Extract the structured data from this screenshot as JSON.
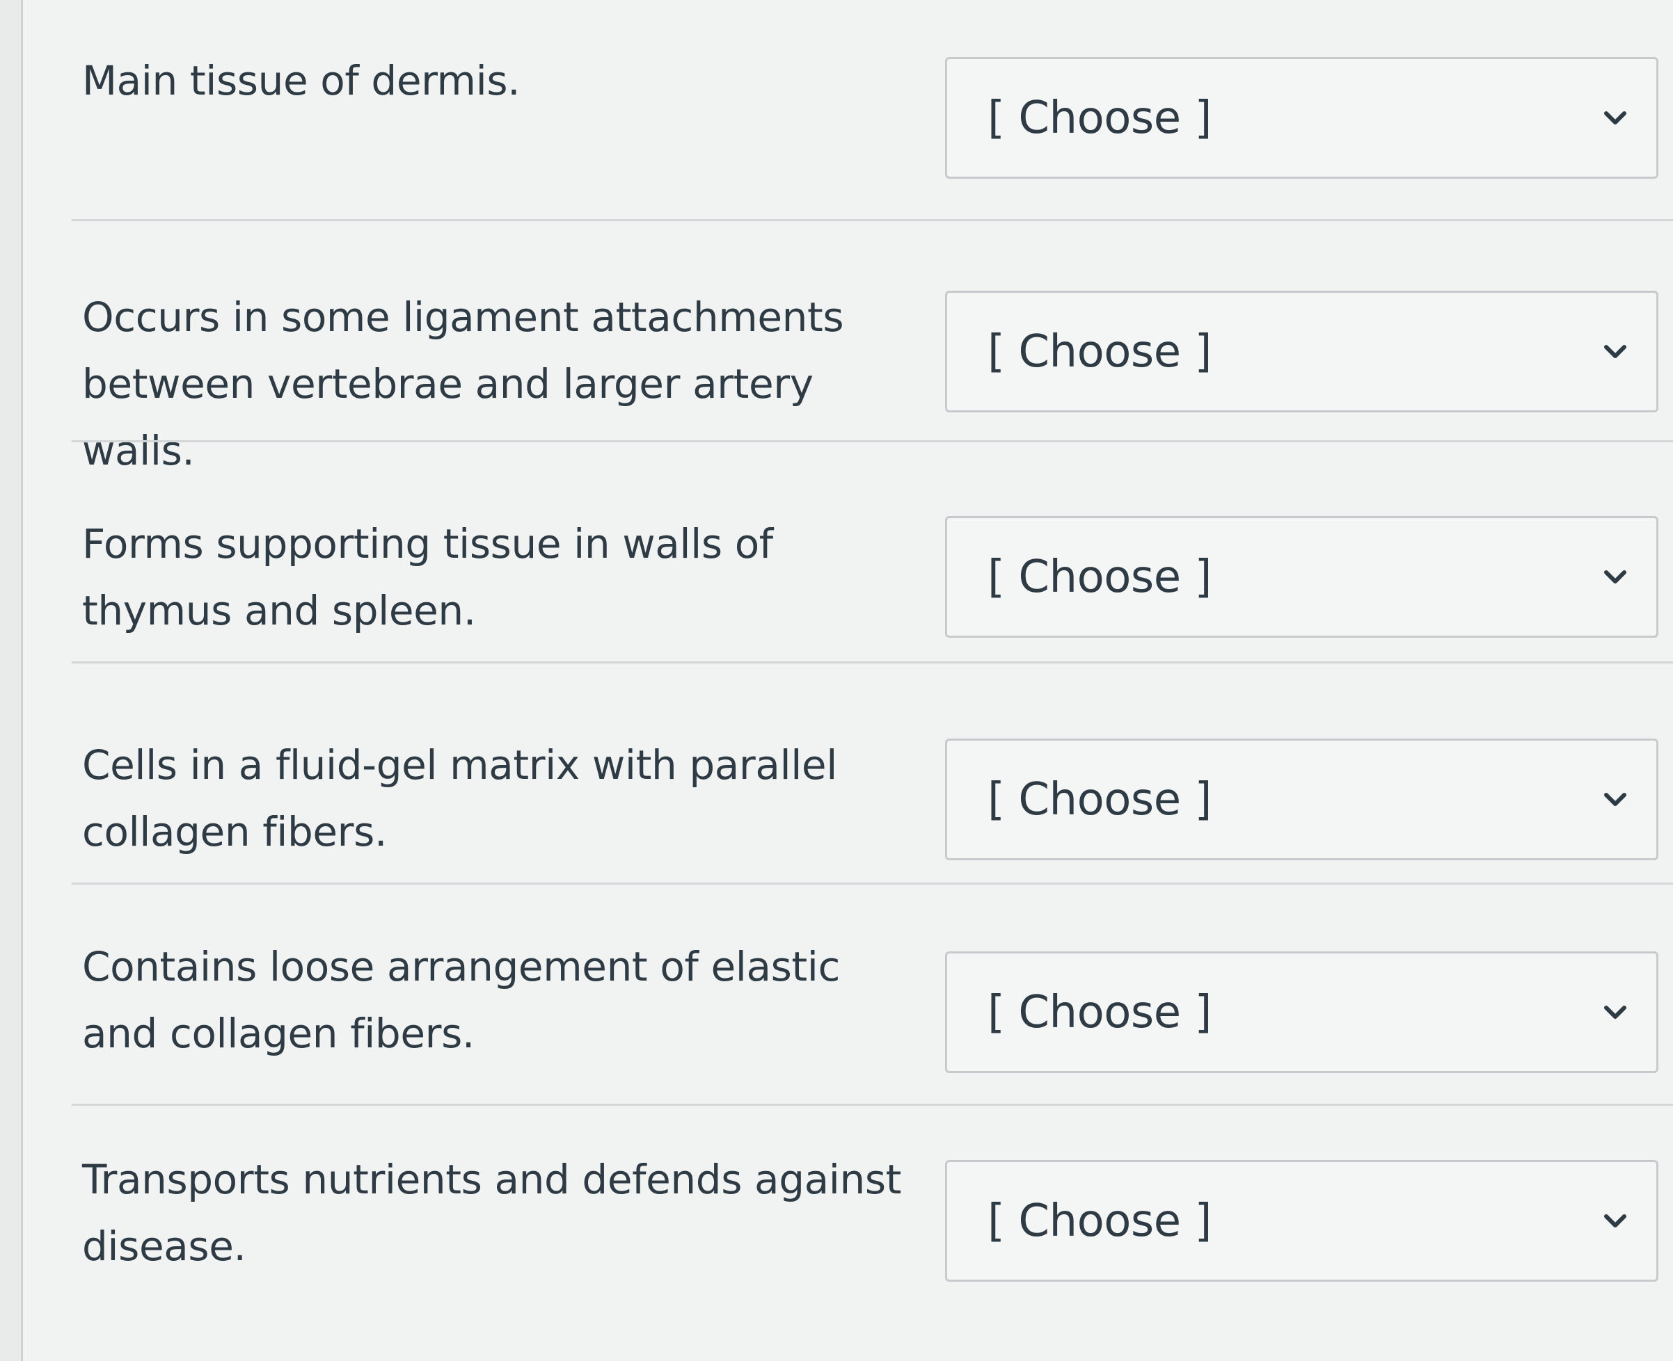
{
  "questions": [
    {
      "prompt": "Main tissue of dermis.",
      "select_value": "[ Choose ]"
    },
    {
      "prompt": "Occurs in some ligament attachments between vertebrae and larger artery walls.",
      "select_value": "[ Choose ]"
    },
    {
      "prompt": "Forms supporting tissue in walls of thymus and spleen.",
      "select_value": "[ Choose ]"
    },
    {
      "prompt": "Cells in a fluid-gel matrix with parallel collagen fibers.",
      "select_value": "[ Choose ]"
    },
    {
      "prompt": "Contains loose arrangement of elastic and collagen fibers.",
      "select_value": "[ Choose ]"
    },
    {
      "prompt": "Transports nutrients and defends against disease.",
      "select_value": "[ Choose ]"
    }
  ],
  "icons": {
    "dropdown": "chevron-down-icon"
  }
}
